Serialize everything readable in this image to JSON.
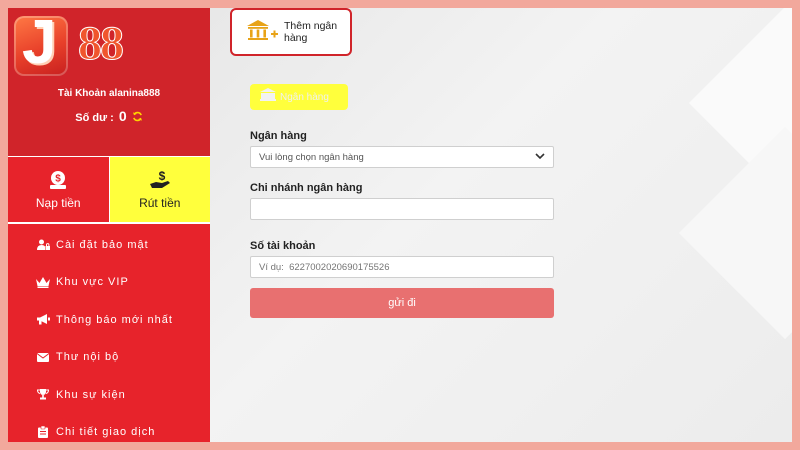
{
  "brand": {
    "logo_letter": "J",
    "logo_number": "88"
  },
  "account": {
    "label": "Tài Khoản alanina888",
    "balance_label": "Số dư :",
    "balance_value": "0"
  },
  "actions": {
    "deposit_label": "Nạp tiền",
    "withdraw_label": "Rút tiền"
  },
  "menu": {
    "items": [
      {
        "label": "Cài đặt bảo mật",
        "icon": "user-lock-icon"
      },
      {
        "label": "Khu vực VIP",
        "icon": "crown-icon"
      },
      {
        "label": "Thông báo mới nhất",
        "icon": "megaphone-icon"
      },
      {
        "label": "Thư nội bộ",
        "icon": "envelope-icon"
      },
      {
        "label": "Khu sự kiện",
        "icon": "trophy-icon"
      },
      {
        "label": "Chi tiết giao dịch",
        "icon": "clipboard-icon"
      }
    ]
  },
  "main": {
    "add_bank_tab": "Thêm ngân hàng",
    "bank_pill": "Ngân hàng",
    "form": {
      "bank_label": "Ngân hàng",
      "bank_select_value": "Vui lòng chọn ngân hàng",
      "branch_label": "Chi nhánh ngân hàng",
      "branch_value": "",
      "account_label": "Số tài khoản",
      "account_placeholder": "Ví dụ:  6227002020690175526",
      "submit_label": "gửi đi"
    }
  },
  "colors": {
    "sidebar_red": "#e7232b",
    "highlight_yellow": "#ffff3c",
    "submit_pink": "#e87070",
    "frame_pink": "#f2a89c"
  }
}
